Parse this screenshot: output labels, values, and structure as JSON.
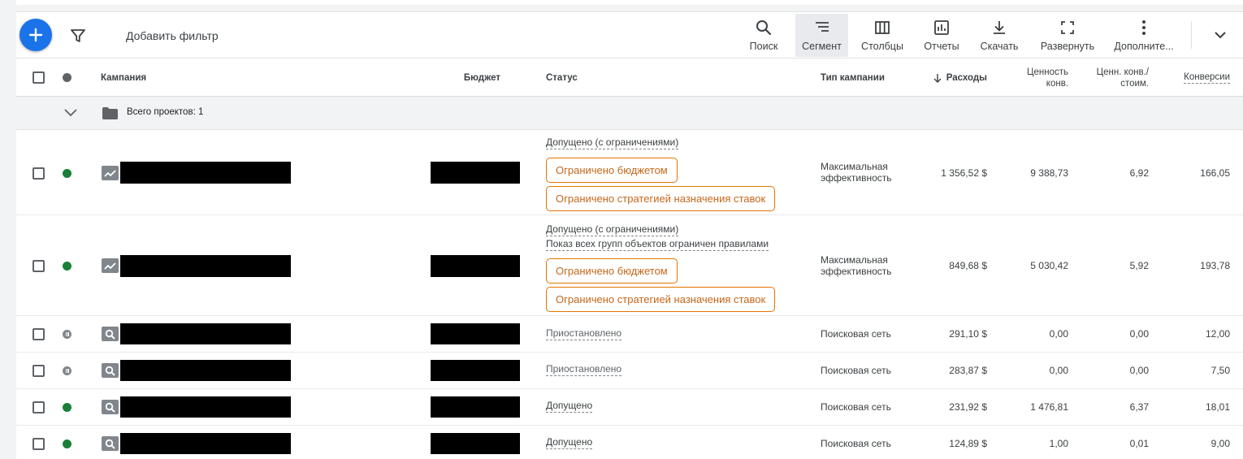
{
  "toolbar": {
    "add_filter": "Добавить фильтр",
    "buttons": [
      {
        "label": "Поиск",
        "icon": "search-icon"
      },
      {
        "label": "Сегмент",
        "icon": "segment-icon",
        "active": true
      },
      {
        "label": "Столбцы",
        "icon": "columns-icon"
      },
      {
        "label": "Отчеты",
        "icon": "reports-icon"
      },
      {
        "label": "Скачать",
        "icon": "download-icon"
      },
      {
        "label": "Развернуть",
        "icon": "expand-icon"
      },
      {
        "label": "Дополните...",
        "icon": "more-icon"
      }
    ]
  },
  "columns": {
    "campaign": "Кампания",
    "budget": "Бюджет",
    "status": "Статус",
    "type": "Тип кампании",
    "cost": "Расходы",
    "conv_value_1": "Ценность",
    "conv_value_2": "конв.",
    "value_cost_1": "Ценн. конв./",
    "value_cost_2": "стоим.",
    "conversions": "Конверсии"
  },
  "group": {
    "label": "Всего проектов: 1"
  },
  "rows": [
    {
      "status_lines": [
        "Допущено (с ограничениями)"
      ],
      "chips": [
        "Ограничено бюджетом",
        "Ограничено стратегией назначения ставок"
      ],
      "type_1": "Максимальная",
      "type_2": "эффективность",
      "cost": "1 356,52 $",
      "conv_value": "9 388,73",
      "value_cost": "6,92",
      "conversions": "166,05",
      "state": "enabled",
      "campaign_type_icon": "performance-icon"
    },
    {
      "status_lines": [
        "Допущено (с ограничениями)",
        "Показ всех групп объектов ограничен правилами"
      ],
      "chips": [
        "Ограничено бюджетом",
        "Ограничено стратегией назначения ставок"
      ],
      "type_1": "Максимальная",
      "type_2": "эффективность",
      "cost": "849,68 $",
      "conv_value": "5 030,42",
      "value_cost": "5,92",
      "conversions": "193,78",
      "state": "enabled",
      "campaign_type_icon": "performance-icon"
    },
    {
      "status": "Приостановлено",
      "type": "Поисковая сеть",
      "cost": "291,10 $",
      "conv_value": "0,00",
      "value_cost": "0,00",
      "conversions": "12,00",
      "state": "paused",
      "campaign_type_icon": "search-campaign-icon"
    },
    {
      "status": "Приостановлено",
      "type": "Поисковая сеть",
      "cost": "283,87 $",
      "conv_value": "0,00",
      "value_cost": "0,00",
      "conversions": "7,50",
      "state": "paused",
      "campaign_type_icon": "search-campaign-icon"
    },
    {
      "status": "Допущено",
      "type": "Поисковая сеть",
      "cost": "231,92 $",
      "conv_value": "1 476,81",
      "value_cost": "6,37",
      "conversions": "18,01",
      "state": "enabled",
      "campaign_type_icon": "search-campaign-icon"
    },
    {
      "status": "Допущено",
      "type": "Поисковая сеть",
      "cost": "124,89 $",
      "conv_value": "1,00",
      "value_cost": "0,01",
      "conversions": "9,00",
      "state": "enabled",
      "campaign_type_icon": "search-campaign-icon"
    }
  ]
}
